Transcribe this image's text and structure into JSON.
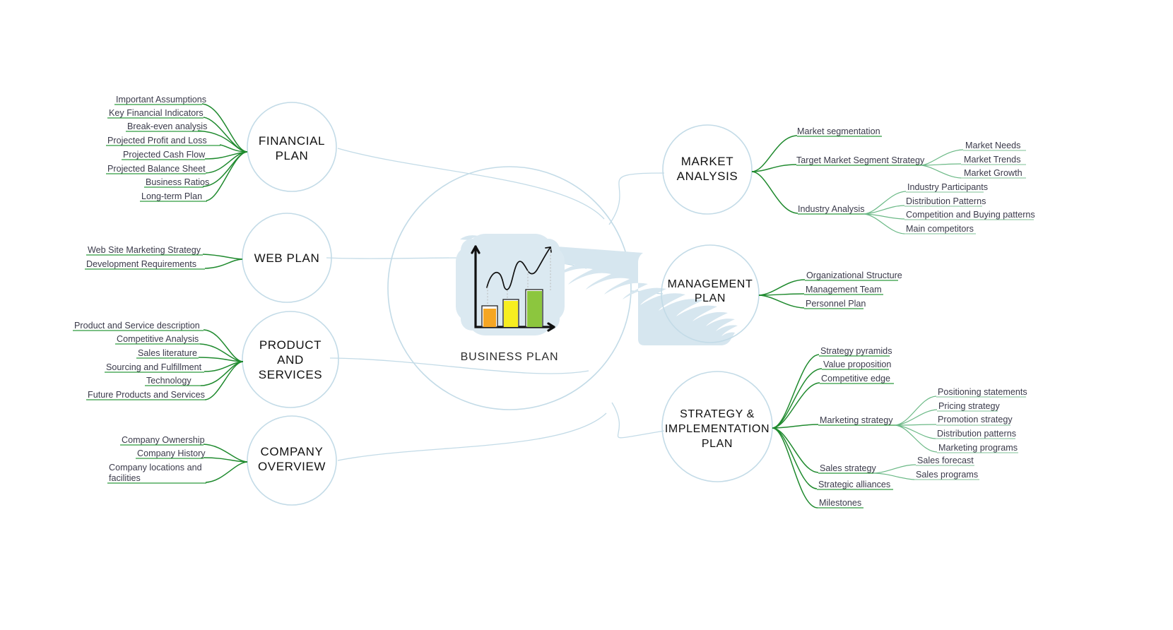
{
  "diagram": {
    "type": "mind-map",
    "title": "BUSINESS PLAN",
    "center": {
      "label": "BUSINESS PLAN",
      "icon": "bar-chart-growth-icon",
      "circle_color": "#c3dbe7"
    },
    "colors": {
      "node_stroke": "#c3dbe7",
      "branch_primary": "#1f8a2e",
      "branch_secondary": "#6bb986",
      "leaf_text": "#3a3a4a",
      "node_text": "#111111",
      "icon_scribble": "#d6e6ef",
      "bar_orange": "#f5a623",
      "bar_yellow": "#f7ee20",
      "bar_green": "#8cc63e"
    },
    "nodes": [
      {
        "id": "financial-plan",
        "label": "FINANCIAL PLAN",
        "side": "left",
        "children": [
          {
            "label": "Important Assumptions"
          },
          {
            "label": "Key Financial Indicators"
          },
          {
            "label": "Break-even analysis"
          },
          {
            "label": "Projected Profit and Loss"
          },
          {
            "label": "Projected Cash Flow"
          },
          {
            "label": "Projected Balance Sheet"
          },
          {
            "label": "Business Ratios"
          },
          {
            "label": "Long-term Plan"
          }
        ]
      },
      {
        "id": "web-plan",
        "label": "WEB PLAN",
        "side": "left",
        "children": [
          {
            "label": "Web Site Marketing Strategy"
          },
          {
            "label": "Development Requirements"
          }
        ]
      },
      {
        "id": "product-and-services",
        "label": "PRODUCT AND SERVICES",
        "side": "left",
        "children": [
          {
            "label": "Product and Service description"
          },
          {
            "label": "Competitive Analysis"
          },
          {
            "label": "Sales literature"
          },
          {
            "label": "Sourcing and Fulfillment"
          },
          {
            "label": "Technology"
          },
          {
            "label": "Future Products and Services"
          }
        ]
      },
      {
        "id": "company-overview",
        "label": "COMPANY OVERVIEW",
        "side": "left",
        "children": [
          {
            "label": "Company Ownership"
          },
          {
            "label": "Company History"
          },
          {
            "label": "Company locations and facilities"
          }
        ]
      },
      {
        "id": "market-analysis",
        "label": "MARKET ANALYSIS",
        "side": "right",
        "children": [
          {
            "label": "Market segmentation"
          },
          {
            "label": "Target Market Segment Strategy",
            "children": [
              {
                "label": "Market Needs"
              },
              {
                "label": "Market Trends"
              },
              {
                "label": "Market Growth"
              }
            ]
          },
          {
            "label": "Industry Analysis",
            "children": [
              {
                "label": "Industry Participants"
              },
              {
                "label": "Distribution Patterns"
              },
              {
                "label": "Competition and Buying patterns"
              },
              {
                "label": "Main competitors"
              }
            ]
          }
        ]
      },
      {
        "id": "management-plan",
        "label": "MANAGEMENT PLAN",
        "side": "right",
        "children": [
          {
            "label": "Organizational Structure"
          },
          {
            "label": "Management Team"
          },
          {
            "label": "Personnel Plan"
          }
        ]
      },
      {
        "id": "strategy-and-implementation-plan",
        "label": "STRATEGY & IMPLEMENTATION PLAN",
        "side": "right",
        "children": [
          {
            "label": "Strategy pyramids"
          },
          {
            "label": "Value proposition"
          },
          {
            "label": "Competitive edge"
          },
          {
            "label": "Marketing strategy",
            "children": [
              {
                "label": "Positioning statements"
              },
              {
                "label": "Pricing strategy"
              },
              {
                "label": "Promotion strategy"
              },
              {
                "label": "Distribution patterns"
              },
              {
                "label": "Marketing programs"
              }
            ]
          },
          {
            "label": "Sales strategy",
            "children": [
              {
                "label": "Sales forecast"
              },
              {
                "label": "Sales programs"
              }
            ]
          },
          {
            "label": "Strategic alliances"
          },
          {
            "label": "Milestones"
          }
        ]
      }
    ],
    "node_labels": {
      "financial_plan_l1": "FINANCIAL",
      "financial_plan_l2": "PLAN",
      "web_plan_l1": "WEB PLAN",
      "product_l1": "PRODUCT",
      "product_l2": "AND",
      "product_l3": "SERVICES",
      "company_l1": "COMPANY",
      "company_l2": "OVERVIEW",
      "market_l1": "MARKET",
      "market_l2": "ANALYSIS",
      "management_l1": "MANAGEMENT",
      "management_l2": "PLAN",
      "strategy_l1": "STRATEGY &",
      "strategy_l2": "IMPLEMENTATION",
      "strategy_l3": "PLAN",
      "company_loc_l1": "Company locations and",
      "company_loc_l2": "facilities"
    }
  }
}
